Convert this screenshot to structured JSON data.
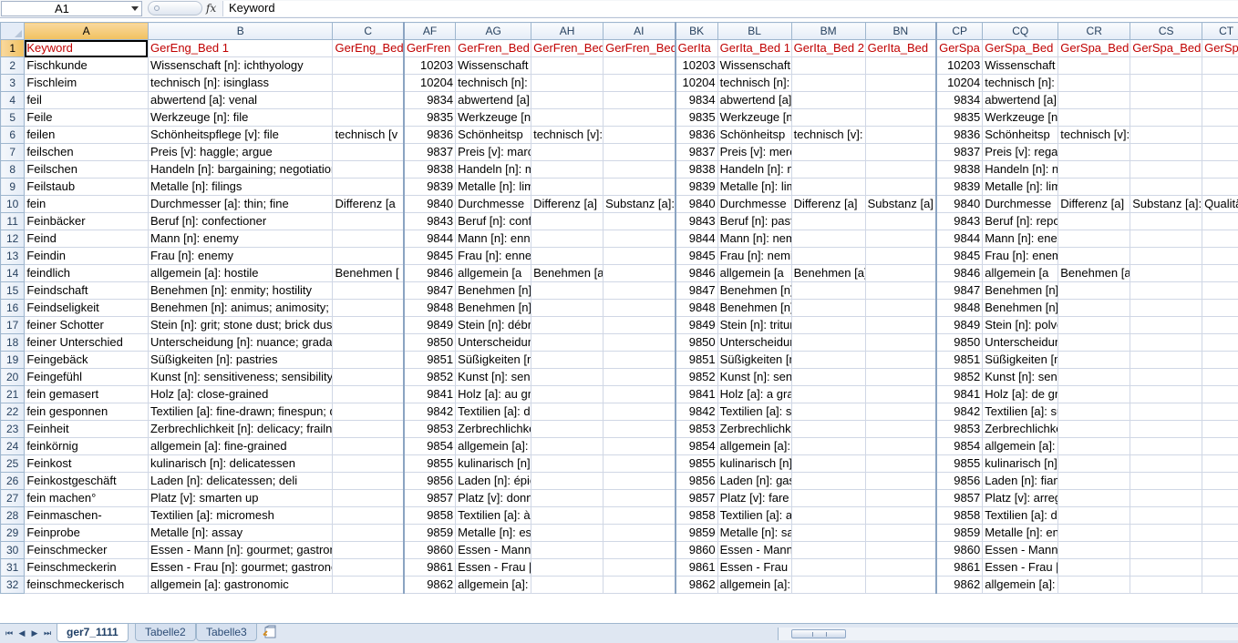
{
  "formula_bar": {
    "name_box": "A1",
    "fx_label": "fx",
    "formula_value": "Keyword"
  },
  "columns": [
    "A",
    "B",
    "C",
    "AF",
    "AG",
    "AH",
    "AI",
    "BK",
    "BL",
    "BM",
    "BN",
    "CP",
    "CQ",
    "CR",
    "CS",
    "CT"
  ],
  "selected_column": "A",
  "rows": [
    [
      "Keyword",
      "GerEng_Bed 1",
      "GerEng_Bed",
      "GerFren",
      "GerFren_Bed",
      "GerFren_Bed",
      "GerFren_Bed",
      "GerIta",
      "GerIta_Bed 1",
      "GerIta_Bed 2",
      "GerIta_Bed",
      "GerSpa",
      "GerSpa_Bed",
      "GerSpa_Bed",
      "GerSpa_Bed",
      "GerSpa"
    ],
    [
      "Fischkunde",
      "Wissenschaft [n]: ichthyology",
      "",
      "10203",
      "Wissenschaft [n]: ichtyologie [f]",
      "",
      "",
      "10203",
      "Wissenschaft [n]: ittiologia [f]",
      "",
      "",
      "10203",
      "Wissenschaft [n]: ictiología [f]",
      "",
      "",
      ""
    ],
    [
      "Fischleim",
      "technisch [n]: isinglass",
      "",
      "10204",
      "technisch [n]: ichtyocolle [f]; colle [f] d",
      "",
      "",
      "10204",
      "technisch [n]: colla [f] di pesce",
      "",
      "",
      "10204",
      "technisch [n]: colapez [f]; colapiz [f (Lat. Amer.)]",
      "",
      "",
      ""
    ],
    [
      "feil",
      "abwertend [a]: venal",
      "",
      "9834",
      "abwertend [a]: vénal",
      "",
      "",
      "9834",
      "abwertend [a]: venale; corrotto",
      "",
      "",
      "9834",
      "abwertend [a]: venal",
      "",
      "",
      ""
    ],
    [
      "Feile",
      "Werkzeuge [n]: file",
      "",
      "9835",
      "Werkzeuge [n]: lime [f]",
      "",
      "",
      "9835",
      "Werkzeuge [n]: lima [f]",
      "",
      "",
      "9835",
      "Werkzeuge [n]: lima [f]",
      "",
      "",
      ""
    ],
    [
      "feilen",
      "Schönheitspflege [v]: file",
      "technisch [v",
      "9836",
      "Schönheitsp",
      "technisch [v]: limer",
      "",
      "9836",
      "Schönheitsp",
      "technisch [v]: limare",
      "",
      "9836",
      "Schönheitsp",
      "technisch [v]: limar",
      "",
      ""
    ],
    [
      "feilschen",
      "Preis [v]: haggle; argue",
      "",
      "9837",
      "Preis [v]: marchander",
      "",
      "",
      "9837",
      "Preis [v]: mercanteggiare",
      "",
      "",
      "9837",
      "Preis [v]: regatear",
      "",
      "",
      ""
    ],
    [
      "Feilschen",
      "Handeln [n]: bargaining; negotiation",
      "",
      "9838",
      "Handeln [n]: marchandage [m]; négoci",
      "",
      "",
      "9838",
      "Handeln [n]: mercanteggiamento [m];",
      "",
      "",
      "9838",
      "Handeln [n]: negociación [f]; regateo [m]",
      "",
      "",
      ""
    ],
    [
      "Feilstaub",
      "Metalle [n]: filings",
      "",
      "9839",
      "Metalle [n]: limaille [f]",
      "",
      "",
      "9839",
      "Metalle [n]: limatura [f]",
      "",
      "",
      "9839",
      "Metalle [n]: limadura [f]",
      "",
      "",
      ""
    ],
    [
      "fein",
      "Durchmesser [a]: thin; fine",
      "Differenz [a",
      "9840",
      "Durchmesse",
      "Differenz [a]",
      "Substanz [a]:",
      "9840",
      "Durchmesse",
      "Differenz [a]",
      "Substanz [a]",
      "9840",
      "Durchmesse",
      "Differenz [a]",
      "Substanz [a]:",
      "Qualität"
    ],
    [
      "Feinbäcker",
      "Beruf [n]: confectioner",
      "",
      "9843",
      "Beruf [n]: confiseur [m]; pâtissier [m]",
      "",
      "",
      "9843",
      "Beruf [n]: pasticciere [m]; caramellaio",
      "",
      "",
      "9843",
      "Beruf [n]: repostero [m]; pastelero [m]; confite",
      "",
      "",
      ""
    ],
    [
      "Feind",
      "Mann [n]: enemy",
      "",
      "9844",
      "Mann [n]: ennemi [m]",
      "",
      "",
      "9844",
      "Mann [n]: nemico [m]",
      "",
      "",
      "9844",
      "Mann [n]: enemigo [m]",
      "",
      "",
      ""
    ],
    [
      "Feindin",
      "Frau [n]: enemy",
      "",
      "9845",
      "Frau [n]: ennemie [f]",
      "",
      "",
      "9845",
      "Frau [n]: nemica [f]",
      "",
      "",
      "9845",
      "Frau [n]: enemiga [f]",
      "",
      "",
      ""
    ],
    [
      "feindlich",
      "allgemein [a]: hostile",
      "Benehmen [",
      "9846",
      "allgemein [a",
      "Benehmen [a]: hostile",
      "",
      "9846",
      "allgemein [a",
      "Benehmen [a]: ostile; ne",
      "",
      "9846",
      "allgemein [a",
      "Benehmen [a]: hostil",
      "",
      ""
    ],
    [
      "Feindschaft",
      "Benehmen [n]: enmity; hostility",
      "",
      "9847",
      "Benehmen [n]: inimitié [f]; hostilité [f]",
      "",
      "",
      "9847",
      "Benehmen [n]: inimicizia [f]; ostilità [f",
      "",
      "",
      "9847",
      "Benehmen [n]: enemistad [f]; hostilidad [f]",
      "",
      "",
      ""
    ],
    [
      "Feindseligkeit",
      "Benehmen [n]: animus; animosity; ill will; er",
      "",
      "9848",
      "Benehmen [n]: animosité [f]; aversion",
      "",
      "",
      "9848",
      "Benehmen [n]: avversione [f]; animos",
      "",
      "",
      "9848",
      "Benehmen [n]: rencor [m]; aversión [f]; enemis",
      "",
      "",
      ""
    ],
    [
      "feiner Schotter",
      "Stein [n]: grit; stone dust; brick dust",
      "",
      "9849",
      "Stein [n]: débris [mp]; poussière [f]",
      "",
      "",
      "9849",
      "Stein [n]: tritume [m]; polvere [f]",
      "",
      "",
      "9849",
      "Stein [n]: polvo [m]; polvillo [m]; gravilla [f]",
      "",
      "",
      ""
    ],
    [
      "feiner Unterschied",
      "Unterscheidung [n]: nuance; gradation",
      "",
      "9850",
      "Unterscheidung [n]: nuance [f]",
      "",
      "",
      "9850",
      "Unterscheidung [n]: sfumatura [f]",
      "",
      "",
      "9850",
      "Unterscheidung [n]: matiz [m]; degradación [f]",
      "",
      "",
      ""
    ],
    [
      "Feingebäck",
      "Süßigkeiten [n]: pastries",
      "",
      "9851",
      "Süßigkeiten [n]: pâtisseries [fp]",
      "",
      "",
      "9851",
      "Süßigkeiten [n]: pasticcini [mp]; paste",
      "",
      "",
      "9851",
      "Süßigkeiten [n]: pasteles [mp]",
      "",
      "",
      ""
    ],
    [
      "Feingefühl",
      "Kunst [n]: sensitiveness; sensibility [formal]",
      "",
      "9852",
      "Kunst [n]: sensibilité [f]",
      "",
      "",
      "9852",
      "Kunst [n]: sensibilità [f (invariable)]",
      "",
      "",
      "9852",
      "Kunst [n]: sensibilidad [f]",
      "",
      "",
      ""
    ],
    [
      "fein gemasert",
      "Holz [a]: close-grained",
      "",
      "9841",
      "Holz [a]: au grain serré",
      "",
      "",
      "9841",
      "Holz [a]: a grana fine",
      "",
      "",
      "9841",
      "Holz [a]: de grano fino",
      "",
      "",
      ""
    ],
    [
      "fein gesponnen",
      "Textilien [a]: fine-drawn; finespun; delicate",
      "",
      "9842",
      "Textilien [a]: délicat; fin",
      "",
      "",
      "9842",
      "Textilien [a]: sottile; fine; delicato",
      "",
      "",
      "9842",
      "Textilien [a]: sutil; fino; delicado",
      "",
      "",
      ""
    ],
    [
      "Feinheit",
      "Zerbrechlichkeit [n]: delicacy; frailness; finer",
      "",
      "9853",
      "Zerbrechlichkeit [n]: délicatesse [f]; fra",
      "",
      "",
      "9853",
      "Zerbrechlichkeit [n]: delicatezza [f]; fi",
      "",
      "",
      "9853",
      "Zerbrechlichkeit [n]: delicadeza [f]; fragilidad [f",
      "",
      "",
      ""
    ],
    [
      "feinkörnig",
      "allgemein [a]: fine-grained",
      "",
      "9854",
      "allgemein [a]: à grain fin",
      "",
      "",
      "9854",
      "allgemein [a]: a grana fine",
      "",
      "",
      "9854",
      "allgemein [a]: de grano fino",
      "",
      "",
      ""
    ],
    [
      "Feinkost",
      "kulinarisch [n]: delicatessen",
      "",
      "9855",
      "kulinarisch [n]: épicerie [f] fine",
      "",
      "",
      "9855",
      "kulinarisch [n]: specialità [fp] gastronc",
      "",
      "",
      "9855",
      "kulinarisch [n]: manjares [mp] gastronómicos",
      "",
      "",
      ""
    ],
    [
      "Feinkostgeschäft",
      "Laden [n]: delicatessen; deli",
      "",
      "9856",
      "Laden [n]: épicerie [f]",
      "",
      "",
      "9856",
      "Laden [n]: gastronomia [f]; rosticceria",
      "",
      "",
      "9856",
      "Laden [n]: fiambrería [f]; tienda [f] de manjares",
      "",
      "",
      ""
    ],
    [
      "fein machen°",
      "Platz [v]: smarten up",
      "",
      "9857",
      "Platz [v]: donner du chic à; arranger",
      "",
      "",
      "9857",
      "Platz [v]: fare bello; abbellire",
      "",
      "",
      "9857",
      "Platz [v]: arreglar",
      "",
      "",
      ""
    ],
    [
      "Feinmaschen-",
      "Textilien [a]: micromesh",
      "",
      "9858",
      "Textilien [a]: à mailles très fines",
      "",
      "",
      "9858",
      "Textilien [a]: a maglia finissima",
      "",
      "",
      "9858",
      "Textilien [a]: de malla fina",
      "",
      "",
      ""
    ],
    [
      "Feinprobe",
      "Metalle [n]: assay",
      "",
      "9859",
      "Metalle [n]: essai [m]",
      "",
      "",
      "9859",
      "Metalle [n]: saggiatura [f]",
      "",
      "",
      "9859",
      "Metalle [n]: ensaye [m]",
      "",
      "",
      ""
    ],
    [
      "Feinschmecker",
      "Essen - Mann [n]: gourmet; gastronome; epic",
      "",
      "9860",
      "Essen - Mann [n]: gourmet [m]; gastron",
      "",
      "",
      "9860",
      "Essen - Mann [n]: buongustaio [m]; go",
      "",
      "",
      "9860",
      "Essen - Mann [n]: gastrónomo [m]",
      "",
      "",
      ""
    ],
    [
      "Feinschmeckerin",
      "Essen - Frau [n]: gourmet; gastronome; epicu",
      "",
      "9861",
      "Essen - Frau [n]: gourmet [m]; gastronc",
      "",
      "",
      "9861",
      "Essen - Frau [n]: buongustaia [f]; gourr",
      "",
      "",
      "9861",
      "Essen - Frau [n]: gastrónoma [f]",
      "",
      "",
      ""
    ],
    [
      "feinschmeckerisch",
      "allgemein [a]: gastronomic",
      "",
      "9862",
      "allgemein [a]: gastronomique",
      "",
      "",
      "9862",
      "allgemein [a]: gastronomico",
      "",
      "",
      "9862",
      "allgemein [a]: gastronómico",
      "",
      "",
      ""
    ]
  ],
  "sheet_tabs": [
    "ger7_1111",
    "Tabelle2",
    "Tabelle3"
  ],
  "active_sheet": "ger7_1111",
  "nav_buttons": [
    "⏮",
    "◀",
    "▶",
    "⏭"
  ]
}
